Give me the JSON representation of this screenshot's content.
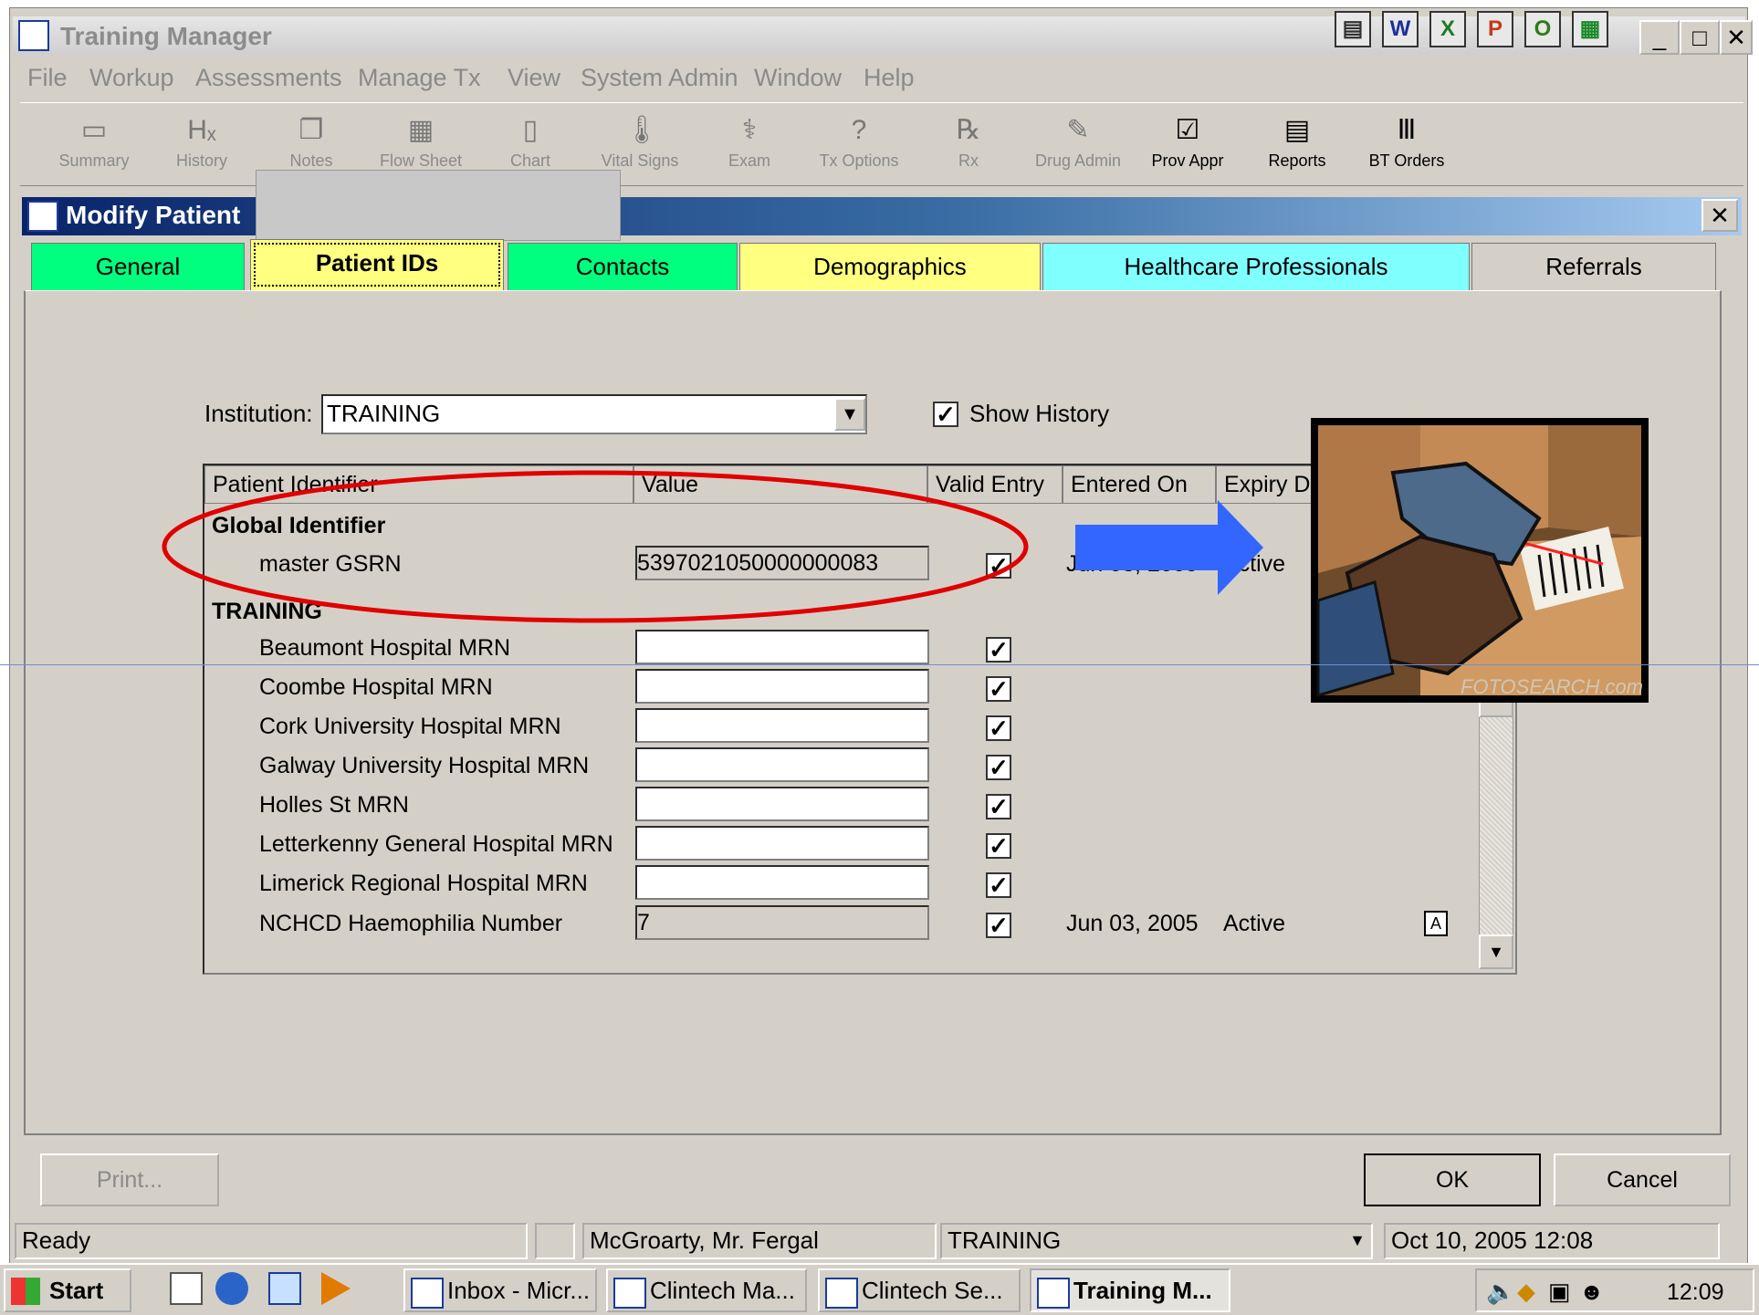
{
  "window": {
    "title": "Training Manager",
    "top_icons": [
      {
        "icon": "dos-icon",
        "glyph": "▤",
        "color": "#303030"
      },
      {
        "icon": "word-icon",
        "glyph": "W",
        "color": "#1d2f9b"
      },
      {
        "icon": "excel-icon",
        "glyph": "X",
        "color": "#1d7a2a"
      },
      {
        "icon": "powerpoint-icon",
        "glyph": "P",
        "color": "#c33a1a"
      },
      {
        "icon": "outlook-icon",
        "glyph": "O",
        "color": "#2d7d1a"
      },
      {
        "icon": "project-icon",
        "glyph": "▦",
        "color": "#1c8a2a"
      }
    ],
    "controls": [
      "_",
      "□",
      "✕"
    ]
  },
  "menu": [
    "File",
    "Workup",
    "Assessments",
    "Manage Tx",
    "View",
    "System Admin",
    "Window",
    "Help"
  ],
  "toolbar": [
    {
      "label": "Summary",
      "icon": "summary-icon",
      "glyph": "▭",
      "enabled": false
    },
    {
      "label": "History",
      "icon": "history-icon",
      "glyph": "Hₓ",
      "enabled": false
    },
    {
      "label": "Notes",
      "icon": "notes-icon",
      "glyph": "❐",
      "enabled": false
    },
    {
      "label": "Flow Sheet",
      "icon": "flowsheet-icon",
      "glyph": "▦",
      "enabled": false
    },
    {
      "label": "Chart",
      "icon": "chart-icon",
      "glyph": "▯",
      "enabled": false
    },
    {
      "label": "Vital Signs",
      "icon": "vital-signs-icon",
      "glyph": "🌡",
      "enabled": false
    },
    {
      "label": "Exam",
      "icon": "exam-icon",
      "glyph": "⚕",
      "enabled": false
    },
    {
      "label": "Tx Options",
      "icon": "tx-options-icon",
      "glyph": "?",
      "enabled": false
    },
    {
      "label": "Rx",
      "icon": "rx-icon",
      "glyph": "℞",
      "enabled": false
    },
    {
      "label": "Drug Admin",
      "icon": "drug-admin-icon",
      "glyph": "✎",
      "enabled": false
    },
    {
      "label": "Prov Appr",
      "icon": "prov-appr-icon",
      "glyph": "☑",
      "enabled": true
    },
    {
      "label": "Reports",
      "icon": "reports-icon",
      "glyph": "▤",
      "enabled": true
    },
    {
      "label": "BT Orders",
      "icon": "bt-orders-icon",
      "glyph": "Ⅲ",
      "enabled": true
    }
  ],
  "mdi": {
    "title": "Modify Patient",
    "close": "✕"
  },
  "tabs": [
    {
      "label": "General",
      "color": "#00ff7f"
    },
    {
      "label": "Patient IDs",
      "color": "#ffff80"
    },
    {
      "label": "Contacts",
      "color": "#00ff7f"
    },
    {
      "label": "Demographics",
      "color": "#ffff80"
    },
    {
      "label": "Healthcare Professionals",
      "color": "#80ffff"
    },
    {
      "label": "Referrals",
      "color": "#d4d0c8"
    }
  ],
  "institution": {
    "label": "Institution:",
    "value": "TRAINING"
  },
  "show_history": {
    "label": "Show History",
    "checked": true
  },
  "grid": {
    "headers": [
      "Patient Identifier",
      "Value",
      "Valid Entry",
      "Entered On",
      "Expiry D"
    ],
    "group1": "Global Identifier",
    "gsrn": {
      "label": "master GSRN",
      "value": "5397021050000000083",
      "entered_on": "Jun 03, 2005",
      "status": "Active"
    },
    "group2": "TRAINING",
    "rows": [
      {
        "label": "Beaumont Hospital MRN",
        "value": ""
      },
      {
        "label": "Coombe Hospital MRN",
        "value": ""
      },
      {
        "label": "Cork University Hospital MRN",
        "value": ""
      },
      {
        "label": "Galway University Hospital MRN",
        "value": ""
      },
      {
        "label": "Holles St MRN",
        "value": ""
      },
      {
        "label": "Letterkenny General Hospital MRN",
        "value": ""
      },
      {
        "label": "Limerick Regional Hospital MRN",
        "value": ""
      }
    ],
    "nchcd": {
      "label": "NCHCD Haemophilia Number",
      "value": "7",
      "entered_on": "Jun 03, 2005",
      "status": "Active"
    }
  },
  "annotation": {
    "ellipse_color": "#e00000",
    "arrow_color": "#3366ff",
    "image_watermark": "FOTOSEARCH.com"
  },
  "buttons": {
    "print": "Print...",
    "ok": "OK",
    "cancel": "Cancel"
  },
  "statusbar": {
    "state": "Ready",
    "user": "McGroarty, Mr. Fergal",
    "institution": "TRAINING",
    "datetime": "Oct 10, 2005 12:08"
  },
  "taskbar": {
    "start": "Start",
    "tasks": [
      "Inbox - Micr...",
      "Clintech Ma...",
      "Clintech Se...",
      "Training M..."
    ],
    "clock": "12:09"
  }
}
